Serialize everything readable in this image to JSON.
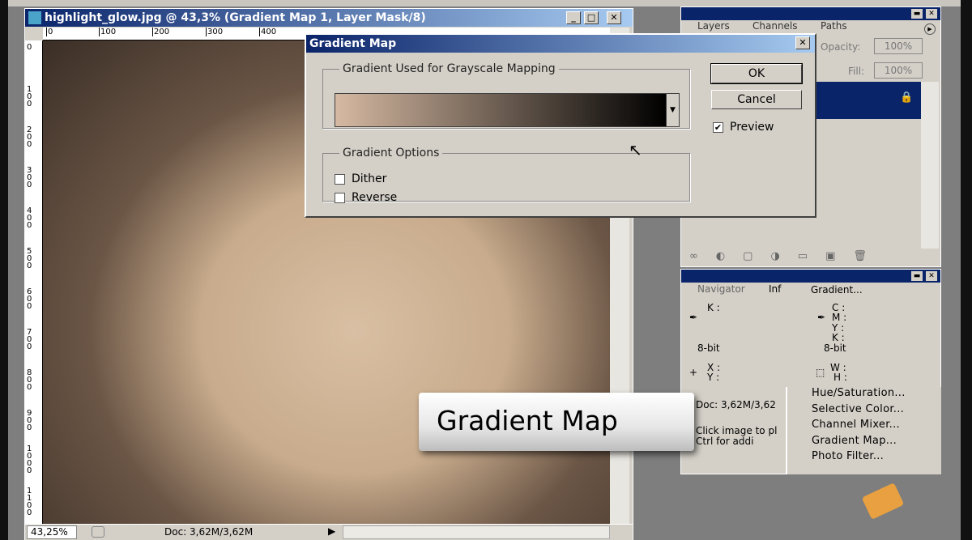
{
  "document": {
    "title": "highlight_glow.jpg @ 43,3% (Gradient Map 1, Layer Mask/8)",
    "ruler_top": [
      "0",
      "100",
      "200",
      "300",
      "400"
    ],
    "ruler_left": [
      "0",
      "100",
      "200",
      "300",
      "400",
      "500",
      "600",
      "700",
      "800",
      "900",
      "1000",
      "1100"
    ],
    "zoom": "43,25%",
    "doc_size": "Doc: 3,62M/3,62M"
  },
  "dialog": {
    "title": "Gradient Map",
    "group1": "Gradient Used for Grayscale Mapping",
    "gradient_colors": [
      "#d6b9a2",
      "#000000"
    ],
    "group2": "Gradient Options",
    "dither": "Dither",
    "dither_checked": false,
    "reverse": "Reverse",
    "reverse_checked": false,
    "ok": "OK",
    "cancel": "Cancel",
    "preview": "Preview",
    "preview_checked": true
  },
  "layers_panel": {
    "tabs": [
      "Layers",
      "Channels",
      "Paths"
    ],
    "opacity_label": "Opacity:",
    "opacity": "100%",
    "fill_label": "Fill:",
    "fill": "100%"
  },
  "info_panel": {
    "tabs": [
      "Navigator",
      "Inf"
    ],
    "k": "K :",
    "bit1": "8-bit",
    "c": "C :",
    "m": "M :",
    "y": "Y :",
    "k2": "K :",
    "bit2": "8-bit",
    "x": "X :",
    "yy": "Y :",
    "w": "W :",
    "h": "H :",
    "doc": "Doc: 3,62M/3,62",
    "hint1": "Click image to pl",
    "hint2": "Ctrl for addi"
  },
  "menu": {
    "items": [
      "Gradient...",
      "Hue/Saturation...",
      "Selective Color...",
      "Channel Mixer...",
      "Gradient Map...",
      "Photo Filter..."
    ]
  },
  "callout": "Gradient Map"
}
